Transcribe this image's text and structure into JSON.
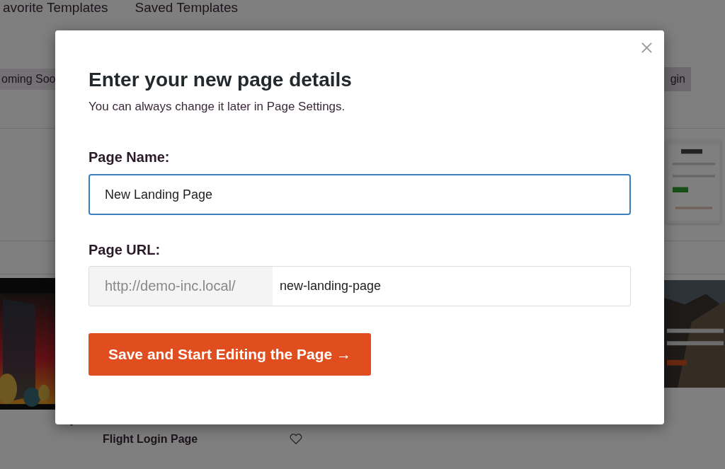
{
  "background": {
    "tabs": [
      {
        "label": "avorite Templates"
      },
      {
        "label": "Saved Templates"
      }
    ],
    "badge": "oming Soo",
    "login_button": "gin",
    "cards": [
      {
        "title": "Flight Login Page"
      }
    ]
  },
  "modal": {
    "title": "Enter your new page details",
    "subtitle": "You can always change it later in Page Settings.",
    "name_label": "Page Name:",
    "name_value": "New Landing Page",
    "url_label": "Page URL:",
    "url_prefix": "http://demo-inc.local/",
    "url_value": "new-landing-page",
    "submit": "Save and Start Editing the Page →"
  }
}
